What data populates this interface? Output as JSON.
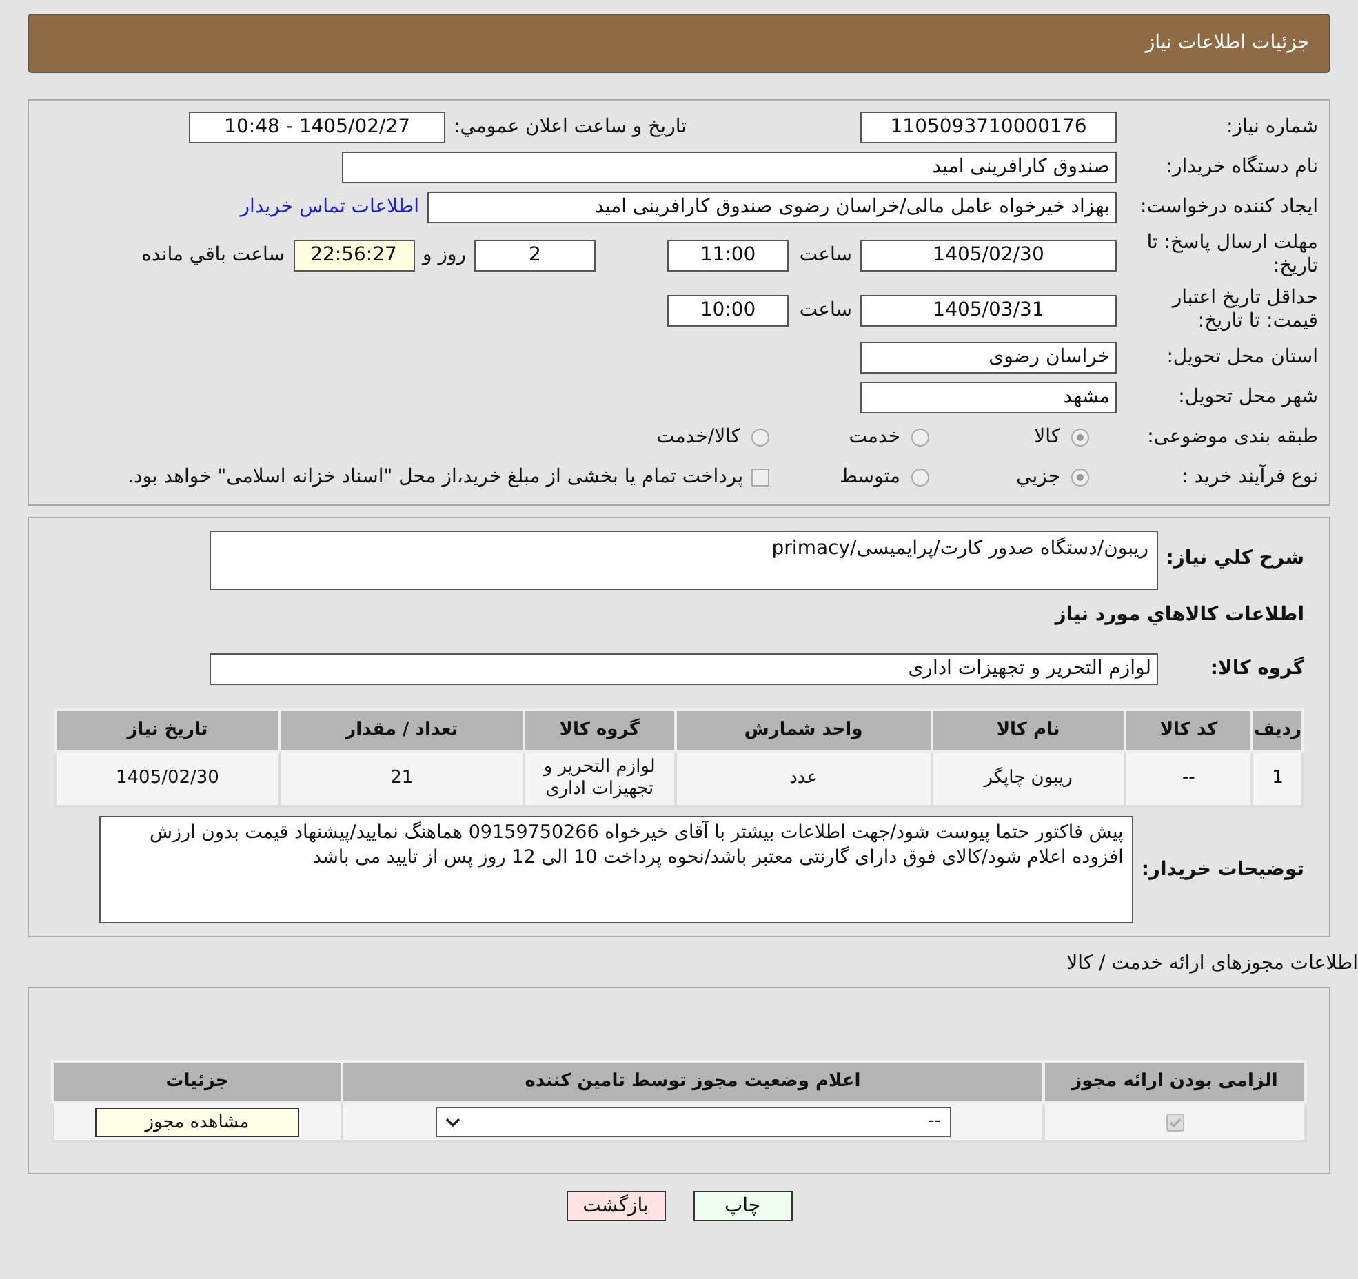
{
  "header": {
    "title": "جزئیات اطلاعات نیاز"
  },
  "details": {
    "need_number": {
      "label": "شماره نیاز:",
      "value": "1105093710000176"
    },
    "announce": {
      "label": "تاریخ و ساعت اعلان عمومي:",
      "value": "1405/02/27 - 10:48"
    },
    "buyer_org": {
      "label": "نام دستگاه خریدار:",
      "value": "صندوق کارافرینی امید"
    },
    "requester": {
      "label": "ایجاد کننده درخواست:",
      "value": "بهزاد خیرخواه عامل مالی/خراسان رضوی صندوق کارافرینی امید",
      "link": "اطلاعات تماس خریدار"
    },
    "deadline": {
      "label": "مهلت ارسال پاسخ: تا تاریخ:",
      "date": "1405/02/30",
      "time_label": "ساعت",
      "time": "11:00",
      "days": "2",
      "days_label": "روز و",
      "remaining": "22:56:27",
      "remaining_label": "ساعت باقي مانده"
    },
    "validity": {
      "label": "حداقل تاریخ اعتبار قیمت: تا تاریخ:",
      "date": "1405/03/31",
      "time_label": "ساعت",
      "time": "10:00"
    },
    "province": {
      "label": "استان محل تحویل:",
      "value": "خراسان رضوی"
    },
    "city": {
      "label": "شهر محل تحویل:",
      "value": "مشهد"
    },
    "category": {
      "label": "طبقه بندی موضوعی:",
      "options": [
        {
          "label": "کالا",
          "selected": true
        },
        {
          "label": "خدمت",
          "selected": false
        },
        {
          "label": "کالا/خدمت",
          "selected": false
        }
      ]
    },
    "purchase_type": {
      "label": "نوع فرآیند خرید :",
      "options": [
        {
          "label": "جزيي",
          "selected": true
        },
        {
          "label": "متوسط",
          "selected": false
        }
      ],
      "payment_note": {
        "label": "پرداخت تمام یا بخشی از مبلغ خرید،از محل \"اسناد خزانه اسلامی\" خواهد بود.",
        "checked": false
      }
    }
  },
  "goods": {
    "description": {
      "label": "شرح کلي نیاز:",
      "value": "ریبون/دستگاه صدور کارت/پرایمیسی/primacy"
    },
    "heading": "اطلاعات کالاهاي مورد نیاز",
    "group": {
      "label": "گروه کالا:",
      "value": "لوازم التحریر و تجهیزات اداری"
    },
    "table": {
      "columns": [
        "ردیف",
        "کد کالا",
        "نام کالا",
        "واحد شمارش",
        "گروه کالا",
        "تعداد / مقدار",
        "تاریخ نیاز"
      ],
      "rows": [
        [
          "1",
          "--",
          "ریبون چاپگر",
          "عدد",
          "لوازم التحریر و تجهیزات اداری",
          "21",
          "1405/02/30"
        ]
      ]
    },
    "buyer_notes": {
      "label": "توضیحات خریدار:",
      "value": "پیش فاکتور حتما پیوست شود/جهت اطلاعات بیشتر با آقای خیرخواه 09159750266 هماهنگ نمایید/پیشنهاد قیمت بدون ارزش افزوده اعلام شود/کالای فوق دارای گارنتی معتبر  باشد/نحوه پرداخت 10 الی 12 روز پس از تایید می باشد"
    }
  },
  "licenses": {
    "heading": "اطلاعات مجوزهای ارائه خدمت / کالا",
    "columns": [
      "الزامی بودن ارائه مجوز",
      "اعلام وضعیت مجوز توسط تامین کننده",
      "جزئیات"
    ],
    "rows": [
      {
        "required": true,
        "disabled": true,
        "status": "--",
        "details_button": "مشاهده مجوز"
      }
    ]
  },
  "buttons": [
    {
      "label": "چاپ",
      "kind": "print"
    },
    {
      "label": "بازگشت",
      "kind": "back"
    }
  ]
}
